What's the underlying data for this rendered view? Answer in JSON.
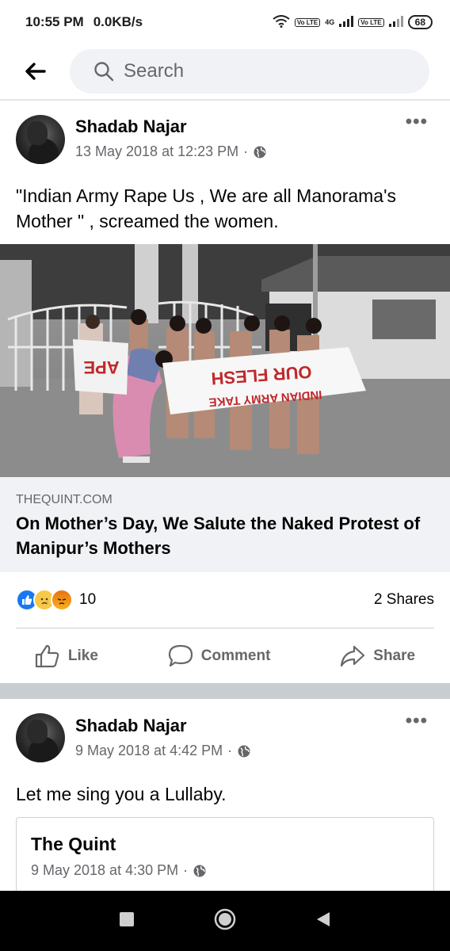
{
  "status_bar": {
    "time": "10:55 PM",
    "speed": "0.0KB/s",
    "network_a": "4G",
    "volte_badge": "Vo LTE",
    "battery": "68"
  },
  "search": {
    "placeholder": "Search"
  },
  "posts": [
    {
      "author": "Shadab Najar",
      "timestamp": "13 May 2018 at 12:23 PM",
      "privacy_icon": "globe-icon",
      "text": "\"Indian Army Rape Us , We are all Manorama's Mother \" , screamed the women.",
      "link": {
        "source": "THEQUINT.COM",
        "title": "On Mother’s Day, We Salute the Naked Protest of Manipur’s Mothers",
        "image_banner_text": "OUR FLESH",
        "image_banner_text_2": "INDIAN ARMY TAKE",
        "image_banner_left_text": "APE"
      },
      "reaction_count": "10",
      "shares": "2 Shares",
      "actions": {
        "like": "Like",
        "comment": "Comment",
        "share": "Share"
      }
    },
    {
      "author": "Shadab Najar",
      "timestamp": "9 May 2018 at 4:42 PM",
      "text": "Let me sing you a Lullaby.",
      "shared": {
        "author": "The Quint",
        "timestamp": "9 May 2018 at 4:30 PM"
      }
    }
  ],
  "colors": {
    "accent": "#1877f2",
    "muted": "#65676b",
    "page_bg": "#ffffff",
    "divider": "#c9ccd1"
  }
}
